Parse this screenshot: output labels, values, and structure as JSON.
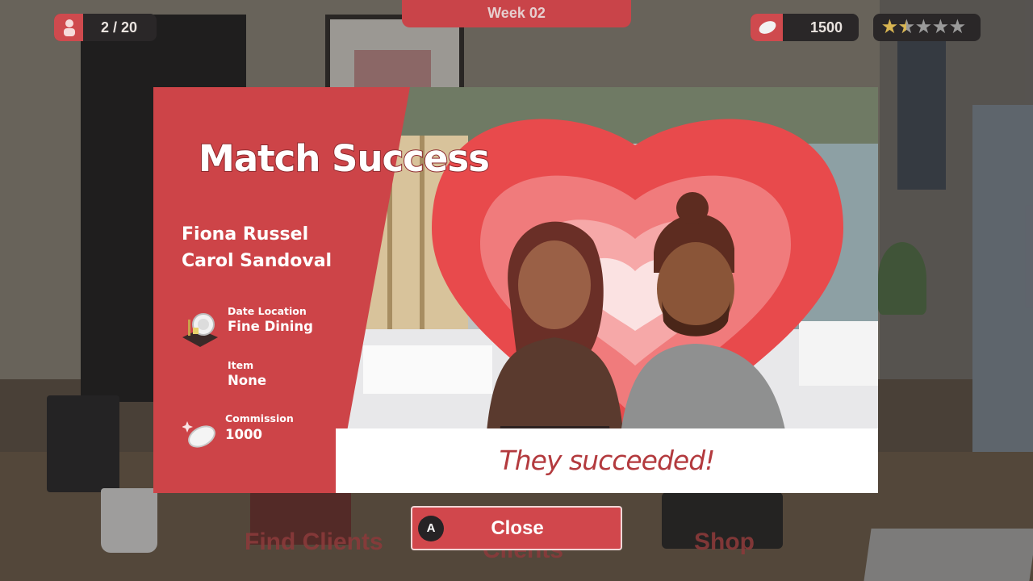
{
  "hud": {
    "clients_count": "2 / 20",
    "week": "Week 02",
    "coins": "1500",
    "rating_stars_filled": 1.5,
    "rating_stars_total": 5
  },
  "bottom_nav": {
    "find_clients": "Find Clients",
    "clients": "Clients",
    "shop": "Shop"
  },
  "dialog": {
    "title": "Match Success",
    "client_a": "Fiona Russel",
    "client_b": "Carol Sandoval",
    "date_location_label": "Date Location",
    "date_location_value": "Fine Dining",
    "item_label": "Item",
    "item_value": "None",
    "commission_label": "Commission",
    "commission_value": "1000",
    "result": "They succeeded!"
  },
  "close_button": {
    "label": "Close",
    "key_hint": "A"
  },
  "colors": {
    "accent": "#cf4449",
    "heart": "#e84a4c",
    "result_text": "#b33a3e"
  },
  "icons": [
    "person-icon",
    "coin-icon",
    "star-icon",
    "dining-plate-icon",
    "coin-icon"
  ]
}
